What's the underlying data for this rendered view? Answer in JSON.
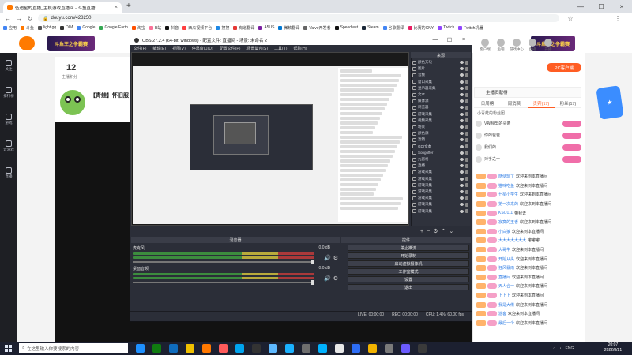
{
  "browser": {
    "tab_title": "伍迪星的直播_主机游戏直播间 - 斗鱼直播",
    "url": "douyu.com/428250",
    "bookmarks": [
      "应用",
      "斗鱼",
      "light.gg",
      "DIM",
      "Google",
      "Google Earth",
      "淘宝",
      "B站",
      "抖音",
      "西瓜视频平台",
      "搜搜",
      "有道翻译",
      "A5US",
      "微软翻译",
      "Valve开发者",
      "Speedtest",
      "Steam",
      "谷歌翻译",
      "比赛的CNY",
      "Twitch",
      "Twitch机器"
    ]
  },
  "douyu": {
    "banner1": "斗鱼王之争霸赛",
    "banner2": "斗鱼王之争霸赛",
    "nav_icons": [
      "客户端",
      "鱼吧",
      "游戏中心",
      "直播",
      "开播"
    ],
    "left_rail": [
      "关注",
      "排行榜",
      "游戏",
      "云游戏",
      "直播"
    ],
    "anchor_count": "12",
    "anchor_label": "主播积分",
    "room_title": "【青蛙】怀旧服",
    "pc_button": "PC客户端",
    "subscribe_text": "主播贡献榜",
    "tabs": [
      "日周榜",
      "周消费",
      "贵宾(17)",
      "粉丝(17)"
    ],
    "contrib_line": "小青蛙的粉丝团",
    "fans": [
      "V视频里的头条",
      "你的爸爸",
      "我们的",
      "对手之一"
    ],
    "chat": [
      {
        "user": "随便玩了",
        "text": "欢迎来到本直播间"
      },
      {
        "user": "猫咪吃鱼",
        "text": "欢迎来到本直播间"
      },
      {
        "user": "七星小学生",
        "text": "欢迎来到本直播间"
      },
      {
        "user": "第一次来的",
        "text": "欢迎来到本直播间"
      },
      {
        "user": "KSO111",
        "text": "带我去"
      },
      {
        "user": "寂寞的王者",
        "text": "欢迎来到本直播间"
      },
      {
        "user": "小白狼",
        "text": "欢迎来到本直播间"
      },
      {
        "user": "大大大大大大大",
        "text": "嘟嘟嘟"
      },
      {
        "user": "大哥牛",
        "text": "欢迎来到本直播间"
      },
      {
        "user": "开始从头",
        "text": "欢迎来到本直播间"
      },
      {
        "user": "狂风暴雨",
        "text": "欢迎来到本直播间"
      },
      {
        "user": "直播间",
        "text": "欢迎来到本直播间"
      },
      {
        "user": "天人合一",
        "text": "欢迎来到本直播间"
      },
      {
        "user": "上上上",
        "text": "欢迎来到本直播间"
      },
      {
        "user": "我是大佬",
        "text": "欢迎来到本直播间"
      },
      {
        "user": "游客",
        "text": "欢迎来到本直播间"
      },
      {
        "user": "最后一个",
        "text": "欢迎来到本直播间"
      }
    ]
  },
  "obs": {
    "title": "OBS 27.2.4 (64-bit, windows) - 配置文件: 直播间 - 场景: 未命名 2",
    "menu": [
      "文件(F)",
      "编辑(E)",
      "视图(V)",
      "停靠窗口(D)",
      "配置文件(P)",
      "场景集合(S)",
      "工具(T)",
      "帮助(H)"
    ],
    "sources_header": "来源",
    "sources": [
      "颜色方块",
      "图片",
      "音频",
      "窗口采集",
      "显示器采集",
      "文本",
      "媒体源",
      "浏览器",
      "游戏采集",
      "视频采集",
      "场景",
      "颜色源",
      "滤镜",
      "GDI文本",
      "Songoffer",
      "九宫格",
      "直播",
      "游戏采集",
      "游戏采集",
      "游戏采集",
      "游戏采集",
      "游戏采集",
      "游戏采集",
      "游戏采集"
    ],
    "mixer_header": "混音器",
    "tracks": [
      {
        "name": "麦克风",
        "db": "0.0 dB"
      },
      {
        "name": "桌面音频",
        "db": "0.0 dB"
      }
    ],
    "controls_header": "控件",
    "controls": [
      "停止推流",
      "开始录制",
      "启动虚拟摄像机",
      "工作室模式",
      "设置",
      "退出"
    ],
    "status": [
      "LIVE: 00:00:00",
      "REC: 00:00:00",
      "CPU: 1.4%, 60.00 fps"
    ]
  },
  "taskbar": {
    "search_placeholder": "在这里输入你要搜索的内容",
    "tray": [
      "ENG"
    ],
    "time": "20:07",
    "date": "2022/8/21"
  }
}
